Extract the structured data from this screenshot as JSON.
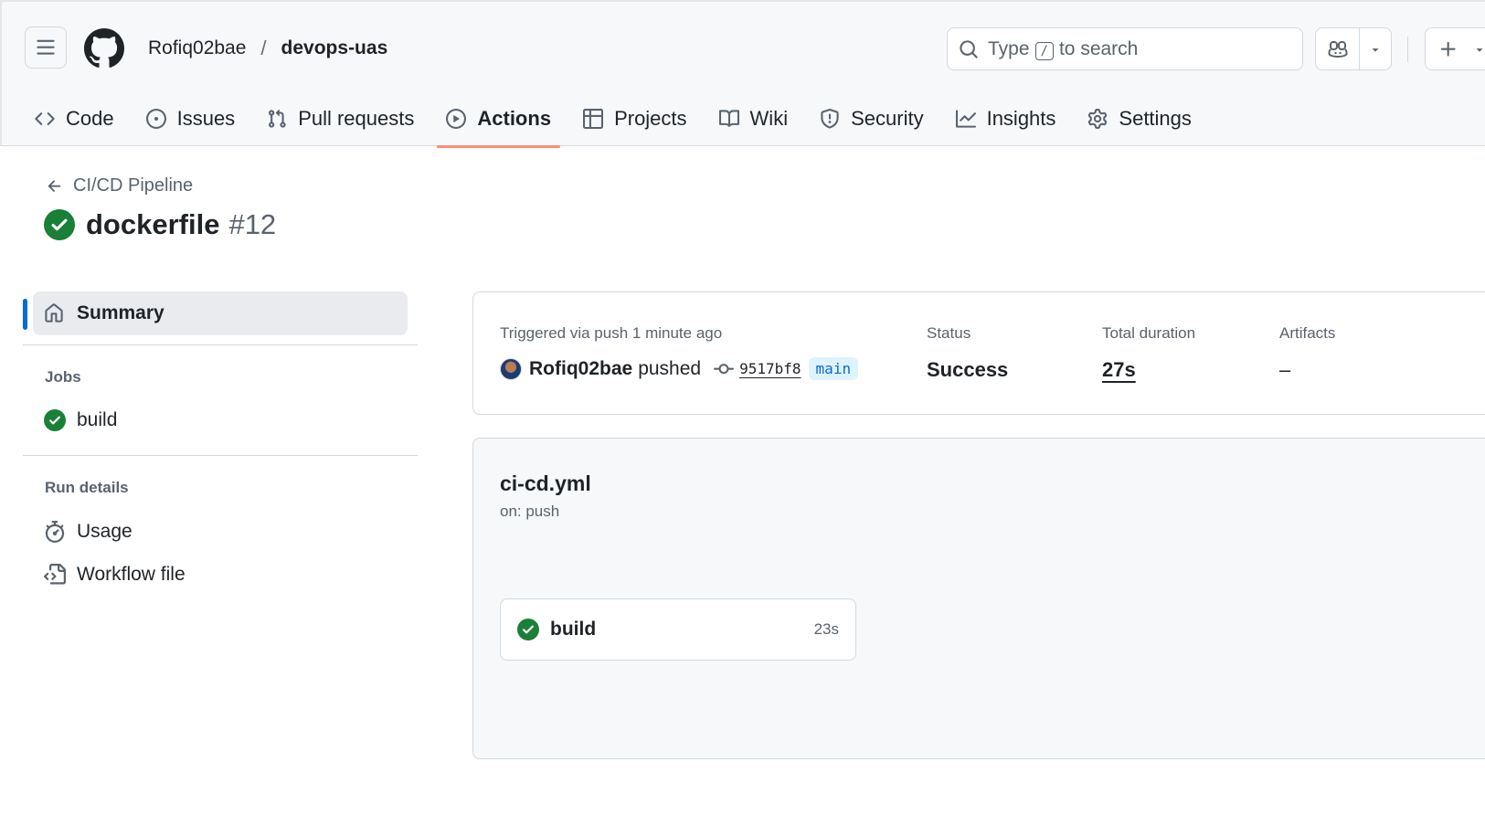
{
  "header": {
    "owner": "Rofiq02bae",
    "separator": "/",
    "repo": "devops-uas",
    "search": {
      "prefix": "Type",
      "key": "/",
      "suffix": "to search"
    }
  },
  "nav": {
    "tabs": [
      {
        "label": "Code",
        "icon": "code-icon"
      },
      {
        "label": "Issues",
        "icon": "issue-icon"
      },
      {
        "label": "Pull requests",
        "icon": "pull-request-icon"
      },
      {
        "label": "Actions",
        "icon": "play-icon",
        "active": true
      },
      {
        "label": "Projects",
        "icon": "table-icon"
      },
      {
        "label": "Wiki",
        "icon": "book-icon"
      },
      {
        "label": "Security",
        "icon": "shield-icon"
      },
      {
        "label": "Insights",
        "icon": "graph-icon"
      },
      {
        "label": "Settings",
        "icon": "gear-icon"
      }
    ]
  },
  "page": {
    "back_label": "CI/CD Pipeline",
    "run_name": "dockerfile",
    "run_number": "#12"
  },
  "sidebar": {
    "summary_label": "Summary",
    "jobs_heading": "Jobs",
    "jobs": [
      {
        "label": "build",
        "status": "success"
      }
    ],
    "run_details_heading": "Run details",
    "usage_label": "Usage",
    "workflow_file_label": "Workflow file"
  },
  "summary": {
    "triggered_text": "Triggered via push 1 minute ago",
    "actor": "Rofiq02bae",
    "action": "pushed",
    "commit_sha": "9517bf8",
    "branch": "main",
    "status_label": "Status",
    "status_value": "Success",
    "duration_label": "Total duration",
    "duration_value": "27s",
    "artifacts_label": "Artifacts",
    "artifacts_value": "–"
  },
  "workflow": {
    "file": "ci-cd.yml",
    "trigger": "on: push",
    "job": {
      "name": "build",
      "duration": "23s"
    }
  },
  "colors": {
    "success": "#1a7f37",
    "accent": "#0969da",
    "active_tab_underline": "#fd8c73"
  }
}
